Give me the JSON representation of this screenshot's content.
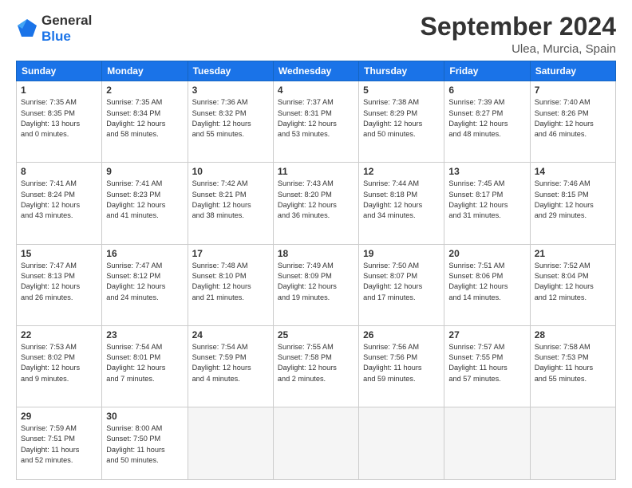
{
  "logo": {
    "line1": "General",
    "line2": "Blue"
  },
  "title": "September 2024",
  "location": "Ulea, Murcia, Spain",
  "weekdays": [
    "Sunday",
    "Monday",
    "Tuesday",
    "Wednesday",
    "Thursday",
    "Friday",
    "Saturday"
  ],
  "weeks": [
    [
      {
        "day": "1",
        "info": "Sunrise: 7:35 AM\nSunset: 8:35 PM\nDaylight: 13 hours\nand 0 minutes."
      },
      {
        "day": "2",
        "info": "Sunrise: 7:35 AM\nSunset: 8:34 PM\nDaylight: 12 hours\nand 58 minutes."
      },
      {
        "day": "3",
        "info": "Sunrise: 7:36 AM\nSunset: 8:32 PM\nDaylight: 12 hours\nand 55 minutes."
      },
      {
        "day": "4",
        "info": "Sunrise: 7:37 AM\nSunset: 8:31 PM\nDaylight: 12 hours\nand 53 minutes."
      },
      {
        "day": "5",
        "info": "Sunrise: 7:38 AM\nSunset: 8:29 PM\nDaylight: 12 hours\nand 50 minutes."
      },
      {
        "day": "6",
        "info": "Sunrise: 7:39 AM\nSunset: 8:27 PM\nDaylight: 12 hours\nand 48 minutes."
      },
      {
        "day": "7",
        "info": "Sunrise: 7:40 AM\nSunset: 8:26 PM\nDaylight: 12 hours\nand 46 minutes."
      }
    ],
    [
      {
        "day": "8",
        "info": "Sunrise: 7:41 AM\nSunset: 8:24 PM\nDaylight: 12 hours\nand 43 minutes."
      },
      {
        "day": "9",
        "info": "Sunrise: 7:41 AM\nSunset: 8:23 PM\nDaylight: 12 hours\nand 41 minutes."
      },
      {
        "day": "10",
        "info": "Sunrise: 7:42 AM\nSunset: 8:21 PM\nDaylight: 12 hours\nand 38 minutes."
      },
      {
        "day": "11",
        "info": "Sunrise: 7:43 AM\nSunset: 8:20 PM\nDaylight: 12 hours\nand 36 minutes."
      },
      {
        "day": "12",
        "info": "Sunrise: 7:44 AM\nSunset: 8:18 PM\nDaylight: 12 hours\nand 34 minutes."
      },
      {
        "day": "13",
        "info": "Sunrise: 7:45 AM\nSunset: 8:17 PM\nDaylight: 12 hours\nand 31 minutes."
      },
      {
        "day": "14",
        "info": "Sunrise: 7:46 AM\nSunset: 8:15 PM\nDaylight: 12 hours\nand 29 minutes."
      }
    ],
    [
      {
        "day": "15",
        "info": "Sunrise: 7:47 AM\nSunset: 8:13 PM\nDaylight: 12 hours\nand 26 minutes."
      },
      {
        "day": "16",
        "info": "Sunrise: 7:47 AM\nSunset: 8:12 PM\nDaylight: 12 hours\nand 24 minutes."
      },
      {
        "day": "17",
        "info": "Sunrise: 7:48 AM\nSunset: 8:10 PM\nDaylight: 12 hours\nand 21 minutes."
      },
      {
        "day": "18",
        "info": "Sunrise: 7:49 AM\nSunset: 8:09 PM\nDaylight: 12 hours\nand 19 minutes."
      },
      {
        "day": "19",
        "info": "Sunrise: 7:50 AM\nSunset: 8:07 PM\nDaylight: 12 hours\nand 17 minutes."
      },
      {
        "day": "20",
        "info": "Sunrise: 7:51 AM\nSunset: 8:06 PM\nDaylight: 12 hours\nand 14 minutes."
      },
      {
        "day": "21",
        "info": "Sunrise: 7:52 AM\nSunset: 8:04 PM\nDaylight: 12 hours\nand 12 minutes."
      }
    ],
    [
      {
        "day": "22",
        "info": "Sunrise: 7:53 AM\nSunset: 8:02 PM\nDaylight: 12 hours\nand 9 minutes."
      },
      {
        "day": "23",
        "info": "Sunrise: 7:54 AM\nSunset: 8:01 PM\nDaylight: 12 hours\nand 7 minutes."
      },
      {
        "day": "24",
        "info": "Sunrise: 7:54 AM\nSunset: 7:59 PM\nDaylight: 12 hours\nand 4 minutes."
      },
      {
        "day": "25",
        "info": "Sunrise: 7:55 AM\nSunset: 7:58 PM\nDaylight: 12 hours\nand 2 minutes."
      },
      {
        "day": "26",
        "info": "Sunrise: 7:56 AM\nSunset: 7:56 PM\nDaylight: 11 hours\nand 59 minutes."
      },
      {
        "day": "27",
        "info": "Sunrise: 7:57 AM\nSunset: 7:55 PM\nDaylight: 11 hours\nand 57 minutes."
      },
      {
        "day": "28",
        "info": "Sunrise: 7:58 AM\nSunset: 7:53 PM\nDaylight: 11 hours\nand 55 minutes."
      }
    ],
    [
      {
        "day": "29",
        "info": "Sunrise: 7:59 AM\nSunset: 7:51 PM\nDaylight: 11 hours\nand 52 minutes."
      },
      {
        "day": "30",
        "info": "Sunrise: 8:00 AM\nSunset: 7:50 PM\nDaylight: 11 hours\nand 50 minutes."
      },
      {
        "day": "",
        "info": ""
      },
      {
        "day": "",
        "info": ""
      },
      {
        "day": "",
        "info": ""
      },
      {
        "day": "",
        "info": ""
      },
      {
        "day": "",
        "info": ""
      }
    ]
  ]
}
